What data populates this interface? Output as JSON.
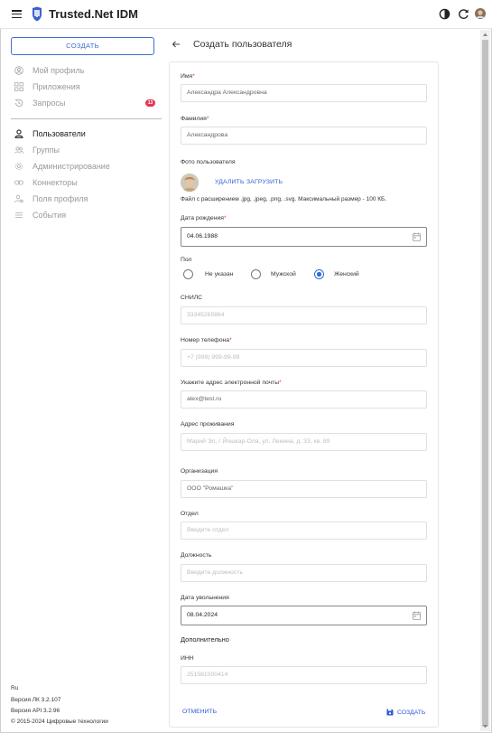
{
  "header": {
    "app_title": "Trusted.Net IDM",
    "icons": [
      "menu-icon",
      "logo-icon",
      "theme-icon",
      "refresh-icon",
      "user-avatar"
    ]
  },
  "sidebar": {
    "create_label": "СОЗДАТЬ",
    "items_top": [
      {
        "label": "Мой профиль",
        "icon": "user-circle-icon"
      },
      {
        "label": "Приложения",
        "icon": "apps-icon"
      },
      {
        "label": "Запросы",
        "icon": "history-icon",
        "badge": "13"
      }
    ],
    "items_admin": [
      {
        "label": "Пользователи",
        "icon": "user-icon",
        "active": true
      },
      {
        "label": "Группы",
        "icon": "group-icon"
      },
      {
        "label": "Администрирование",
        "icon": "gear-icon"
      },
      {
        "label": "Коннекторы",
        "icon": "link-icon"
      },
      {
        "label": "Поля профиля",
        "icon": "profile-fields-icon"
      },
      {
        "label": "События",
        "icon": "list-icon"
      }
    ],
    "footer": {
      "language": "Ru",
      "version_lk": "Версия ЛК 3.2.107",
      "version_api": "Версия API 3.2.96",
      "copyright": "© 2015-2024 Цифровые технологии"
    }
  },
  "main": {
    "title": "Создать пользователя",
    "form": {
      "first_name": {
        "label": "Имя",
        "value": "Александра Александровна"
      },
      "last_name": {
        "label": "Фамилия",
        "value": "Александрова"
      },
      "photo": {
        "label": "Фото пользователя",
        "delete_label": "УДАЛИТЬ",
        "upload_label": "ЗАГРУЗИТЬ",
        "hint": "Файл с расширением .jpg, .jpeg, .png, .svg. Максимальный размер - 100 КБ."
      },
      "birth_date": {
        "label": "Дата рождения",
        "value": "04.06.1988"
      },
      "gender": {
        "label": "Пол",
        "options": [
          "Не указан",
          "Мужской",
          "Женский"
        ],
        "selected": "Женский"
      },
      "snils": {
        "label": "СНИЛС",
        "value": "33345265864"
      },
      "phone": {
        "label": "Номер телефона",
        "value": "+7 (999) 999-99-99"
      },
      "email": {
        "label": "Укажите адрес электронной почты",
        "value": "alex@test.ru"
      },
      "address": {
        "label": "Адрес проживания",
        "value": "Марий Эл, г Йошкар-Ола, ул. Ленина, д. 33, кв. 89"
      },
      "organization": {
        "label": "Организация",
        "value": "ООО \"Ромашка\""
      },
      "department": {
        "label": "Отдел",
        "placeholder": "Введите отдел"
      },
      "position": {
        "label": "Должность",
        "placeholder": "Введите должность"
      },
      "dismissal_date": {
        "label": "Дата увольнения",
        "value": "08.04.2024"
      },
      "additional": {
        "title": "Дополнительно"
      },
      "inn": {
        "label": "ИНН",
        "value": "251581000414"
      },
      "cancel_label": "ОТМЕНИТЬ",
      "submit_label": "СОЗДАТЬ"
    }
  }
}
